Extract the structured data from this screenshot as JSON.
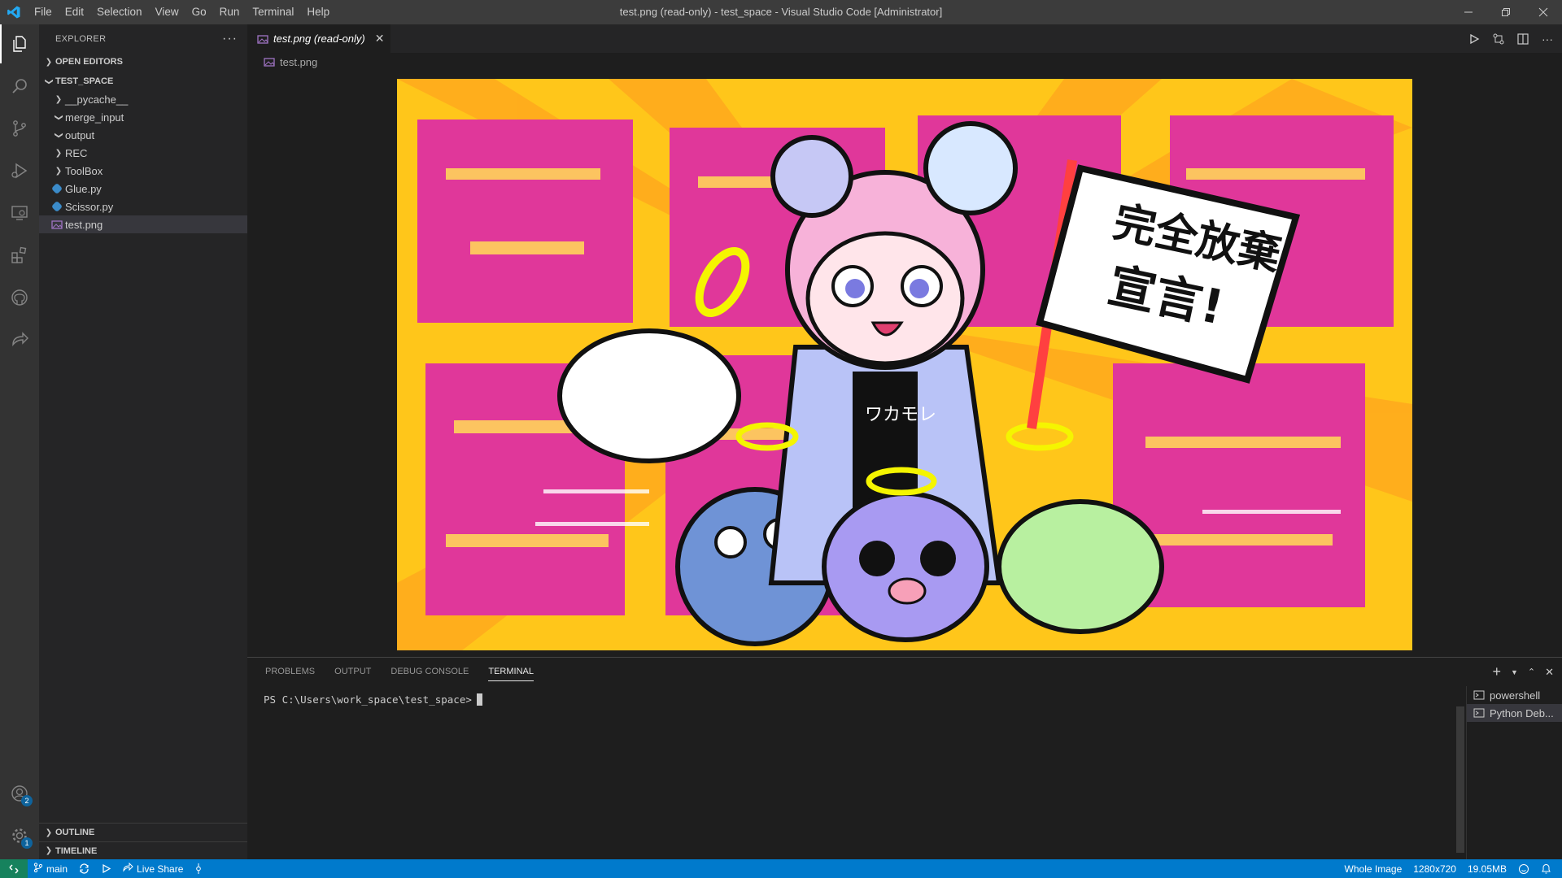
{
  "window": {
    "title": "test.png (read-only) - test_space - Visual Studio Code [Administrator]"
  },
  "menu": [
    "File",
    "Edit",
    "Selection",
    "View",
    "Go",
    "Run",
    "Terminal",
    "Help"
  ],
  "sidebar": {
    "header": "EXPLORER",
    "open_editors": "OPEN EDITORS",
    "workspace": "TEST_SPACE",
    "items": [
      {
        "label": "__pycache__",
        "kind": "folder",
        "expanded": false
      },
      {
        "label": "merge_input",
        "kind": "folder",
        "expanded": true
      },
      {
        "label": "output",
        "kind": "folder",
        "expanded": true
      },
      {
        "label": "REC",
        "kind": "folder",
        "expanded": false
      },
      {
        "label": "ToolBox",
        "kind": "folder",
        "expanded": false
      },
      {
        "label": "Glue.py",
        "kind": "python-file"
      },
      {
        "label": "Scissor.py",
        "kind": "python-file"
      },
      {
        "label": "test.png",
        "kind": "image-file",
        "selected": true
      }
    ],
    "outline": "OUTLINE",
    "timeline": "TIMELINE"
  },
  "editor": {
    "tab_label": "test.png (read-only)",
    "breadcrumb": "test.png",
    "image_caption_lines": [
      "完全放棄",
      "宣言!"
    ],
    "shirt_text": "ワカモレ"
  },
  "panel": {
    "tabs": [
      "PROBLEMS",
      "OUTPUT",
      "DEBUG CONSOLE",
      "TERMINAL"
    ],
    "active_tab": "TERMINAL",
    "prompt": "PS C:\\Users\\work_space\\test_space>",
    "terminals": [
      "powershell",
      "Python Deb..."
    ]
  },
  "activity": {
    "accounts_badge": "2",
    "settings_badge": "1"
  },
  "statusbar": {
    "branch": "main",
    "live_share": "Live Share",
    "image_mode": "Whole Image",
    "dimensions": "1280x720",
    "file_size": "19.05MB"
  },
  "colors": {
    "statusbar": "#007acc",
    "remote": "#16825d",
    "titlebar": "#3c3c3c",
    "activitybar": "#333333",
    "sidebar": "#252526",
    "editor": "#1e1e1e",
    "image_yellow": "#ffc61a",
    "image_magenta": "#e0379a"
  }
}
